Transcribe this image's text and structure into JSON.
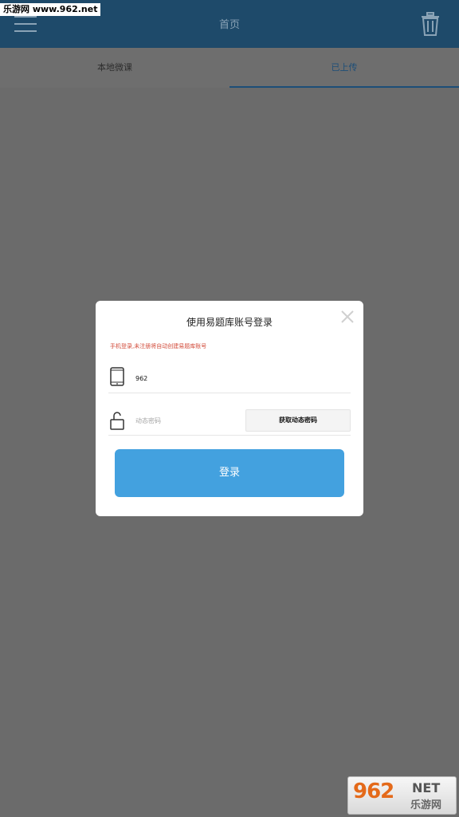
{
  "watermark": {
    "site": "乐游网 www.962.net",
    "logo_num": "962",
    "logo_net": "NET",
    "logo_cn": "乐游网"
  },
  "appbar": {
    "title": "首页",
    "menu_icon": "hamburger-icon",
    "trash_icon": "trash-icon"
  },
  "tabs": [
    {
      "label": "本地微课",
      "active": false
    },
    {
      "label": "已上传",
      "active": true
    }
  ],
  "dialog": {
    "title": "使用易题库账号登录",
    "hint": "手机登录,未注册将自动创建易题库账号",
    "phone_value": "962",
    "password_placeholder": "动态密码",
    "otp_button": "获取动态密码",
    "login_button": "登录"
  },
  "colors": {
    "overlay": "#6b6b6b",
    "accent": "#43a1df",
    "hint": "#d24b3a",
    "active_tab": "#1d4e78"
  }
}
